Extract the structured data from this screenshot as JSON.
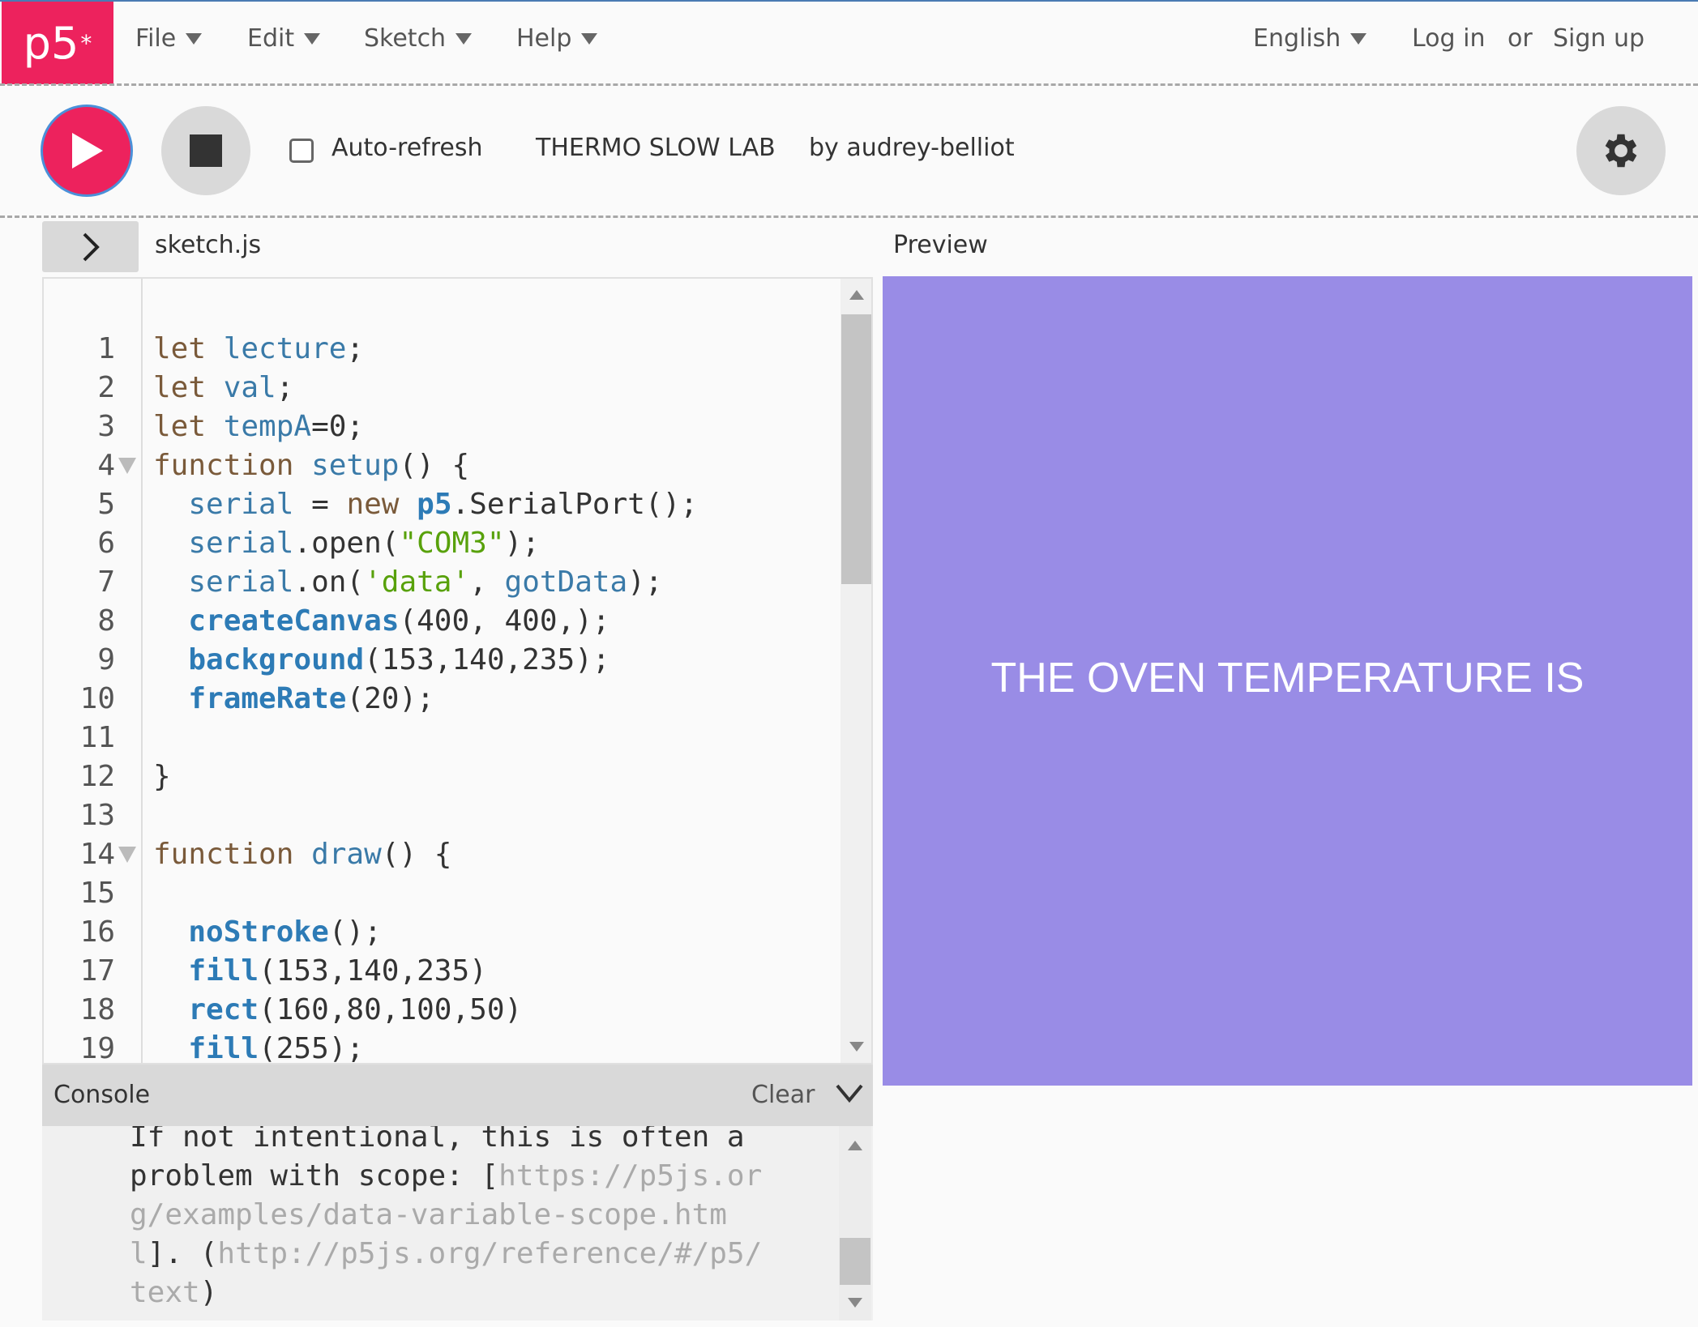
{
  "header": {
    "logo": "p5",
    "logo_mark": "*",
    "menus": [
      {
        "label": "File"
      },
      {
        "label": "Edit"
      },
      {
        "label": "Sketch"
      },
      {
        "label": "Help"
      }
    ],
    "language": "English",
    "login": "Log in",
    "or": "or",
    "signup": "Sign up"
  },
  "toolbar": {
    "auto_refresh_label": "Auto-refresh",
    "auto_refresh_checked": false,
    "sketch_name": "THERMO SLOW LAB",
    "author": "by audrey-belliot"
  },
  "editor": {
    "filename": "sketch.js",
    "lines": [
      {
        "n": "1",
        "tokens": [
          [
            "kw",
            "let "
          ],
          [
            "var",
            "lecture"
          ],
          [
            "plain",
            ";"
          ]
        ]
      },
      {
        "n": "2",
        "tokens": [
          [
            "kw",
            "let "
          ],
          [
            "var",
            "val"
          ],
          [
            "plain",
            ";"
          ]
        ]
      },
      {
        "n": "3",
        "tokens": [
          [
            "kw",
            "let "
          ],
          [
            "var",
            "tempA"
          ],
          [
            "plain",
            "=0;"
          ]
        ]
      },
      {
        "n": "4",
        "fold": true,
        "tokens": [
          [
            "kw",
            "function "
          ],
          [
            "var",
            "setup"
          ],
          [
            "plain",
            "() {"
          ]
        ]
      },
      {
        "n": "5",
        "tokens": [
          [
            "plain",
            "  "
          ],
          [
            "var",
            "serial"
          ],
          [
            "plain",
            " = "
          ],
          [
            "kw",
            "new "
          ],
          [
            "fn",
            "p5"
          ],
          [
            "plain",
            ".SerialPort();"
          ]
        ]
      },
      {
        "n": "6",
        "tokens": [
          [
            "plain",
            "  "
          ],
          [
            "var",
            "serial"
          ],
          [
            "plain",
            ".open("
          ],
          [
            "str",
            "\"COM3\""
          ],
          [
            "plain",
            ");"
          ]
        ]
      },
      {
        "n": "7",
        "tokens": [
          [
            "plain",
            "  "
          ],
          [
            "var",
            "serial"
          ],
          [
            "plain",
            ".on("
          ],
          [
            "str",
            "'data'"
          ],
          [
            "plain",
            ", "
          ],
          [
            "var",
            "gotData"
          ],
          [
            "plain",
            ");"
          ]
        ]
      },
      {
        "n": "8",
        "tokens": [
          [
            "plain",
            "  "
          ],
          [
            "fn",
            "createCanvas"
          ],
          [
            "plain",
            "(400, 400,);"
          ]
        ]
      },
      {
        "n": "9",
        "tokens": [
          [
            "plain",
            "  "
          ],
          [
            "fn",
            "background"
          ],
          [
            "plain",
            "(153,140,235);"
          ]
        ]
      },
      {
        "n": "10",
        "tokens": [
          [
            "plain",
            "  "
          ],
          [
            "fn",
            "frameRate"
          ],
          [
            "plain",
            "(20);"
          ]
        ]
      },
      {
        "n": "11",
        "tokens": []
      },
      {
        "n": "12",
        "tokens": [
          [
            "plain",
            "}"
          ]
        ]
      },
      {
        "n": "13",
        "tokens": []
      },
      {
        "n": "14",
        "fold": true,
        "tokens": [
          [
            "kw",
            "function "
          ],
          [
            "var",
            "draw"
          ],
          [
            "plain",
            "() {"
          ]
        ]
      },
      {
        "n": "15",
        "tokens": []
      },
      {
        "n": "16",
        "tokens": [
          [
            "plain",
            "  "
          ],
          [
            "fn",
            "noStroke"
          ],
          [
            "plain",
            "();"
          ]
        ]
      },
      {
        "n": "17",
        "tokens": [
          [
            "plain",
            "  "
          ],
          [
            "fn",
            "fill"
          ],
          [
            "plain",
            "(153,140,235)"
          ]
        ]
      },
      {
        "n": "18",
        "tokens": [
          [
            "plain",
            "  "
          ],
          [
            "fn",
            "rect"
          ],
          [
            "plain",
            "(160,80,100,50)"
          ]
        ]
      },
      {
        "n": "19",
        "tokens": [
          [
            "plain",
            "  "
          ],
          [
            "fn",
            "fill"
          ],
          [
            "plain",
            "(255);"
          ]
        ]
      }
    ]
  },
  "console": {
    "title": "Console",
    "clear": "Clear",
    "lines": [
      [
        [
          "plain",
          "If not intentional, this is often a"
        ]
      ],
      [
        [
          "plain",
          "problem with scope: ["
        ],
        [
          "link",
          "https://p5js.or"
        ]
      ],
      [
        [
          "link",
          "g/examples/data-variable-scope.htm"
        ]
      ],
      [
        [
          "link",
          "l"
        ],
        [
          "plain",
          "]. ("
        ],
        [
          "link",
          "http://p5js.org/reference/#/p5/"
        ]
      ],
      [
        [
          "link",
          "text"
        ],
        [
          "plain",
          ")"
        ]
      ]
    ]
  },
  "preview": {
    "label": "Preview",
    "canvas_text": "THE OVEN TEMPERATURE IS",
    "canvas_color": "#998ce6"
  },
  "colors": {
    "brand": "#ed225d",
    "accent_border": "#4a90d9"
  }
}
